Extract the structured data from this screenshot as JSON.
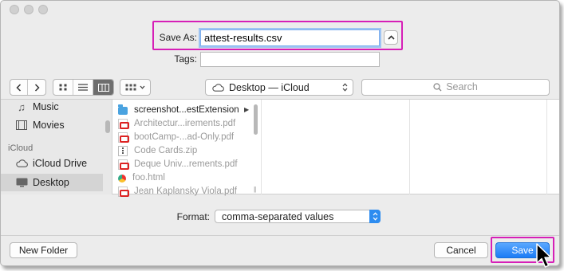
{
  "save_as": {
    "label": "Save As:",
    "filename": "attest-results.csv"
  },
  "tags": {
    "label": "Tags:",
    "value": ""
  },
  "toolbar": {
    "location": "Desktop — iCloud",
    "search_placeholder": "Search"
  },
  "sidebar": {
    "items_top": [
      {
        "label": "Music",
        "icon": "music-note-icon"
      },
      {
        "label": "Movies",
        "icon": "film-icon"
      }
    ],
    "section_icloud": "iCloud",
    "items_icloud": [
      {
        "label": "iCloud Drive",
        "icon": "cloud-icon"
      },
      {
        "label": "Desktop",
        "icon": "desktop-icon",
        "selected": true
      }
    ]
  },
  "files": [
    {
      "name": "screenshot...estExtension",
      "type": "folder",
      "dim": false
    },
    {
      "name": "Architectur...irements.pdf",
      "type": "pdf",
      "dim": true
    },
    {
      "name": "bootCamp-...ad-Only.pdf",
      "type": "pdf",
      "dim": true
    },
    {
      "name": "Code Cards.zip",
      "type": "zip",
      "dim": true
    },
    {
      "name": "Deque Univ...rements.pdf",
      "type": "pdf",
      "dim": true
    },
    {
      "name": "foo.html",
      "type": "html",
      "dim": true
    },
    {
      "name": "Jean Kaplansky Viola.pdf",
      "type": "pdf",
      "dim": true
    }
  ],
  "format": {
    "label": "Format:",
    "value": "comma-separated values"
  },
  "buttons": {
    "new_folder": "New Folder",
    "cancel": "Cancel",
    "save": "Save"
  },
  "colors": {
    "highlight": "#d61fb7",
    "accent": "#1b7cf5"
  }
}
